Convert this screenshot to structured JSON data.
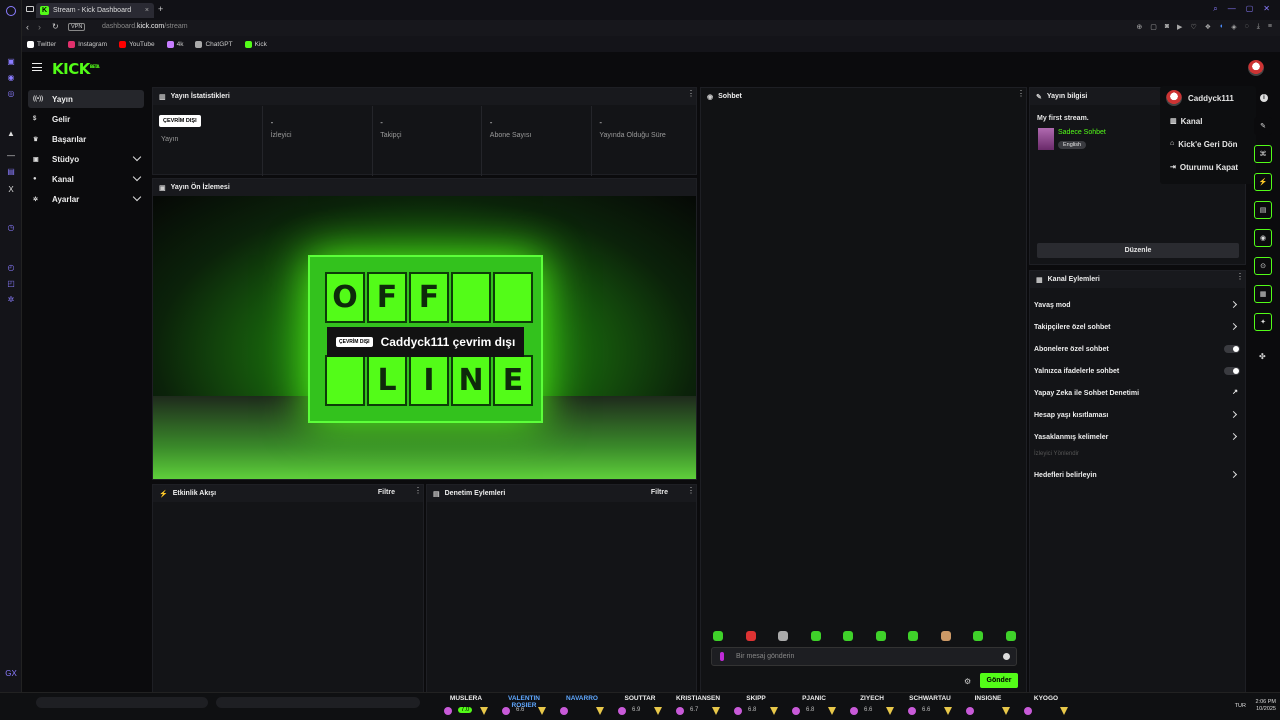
{
  "browser": {
    "tab_title": "Stream - Kick Dashboard",
    "url_domain": "dashboard.",
    "url_host": "kick.com",
    "url_path": "/stream",
    "vpn": "VPN"
  },
  "bookmarks": [
    {
      "label": "Twitter",
      "icon": "x-icon",
      "color": "#ffffff"
    },
    {
      "label": "Instagram",
      "icon": "instagram-icon",
      "color": "#e1306c"
    },
    {
      "label": "YouTube",
      "icon": "youtube-icon",
      "color": "#ff0000"
    },
    {
      "label": "4k",
      "icon": "gem-icon",
      "color": "#c77dff"
    },
    {
      "label": "ChatGPT",
      "icon": "chatgpt-icon",
      "color": "#aaaaaa"
    },
    {
      "label": "Kick",
      "icon": "kick-icon",
      "color": "#53fc18"
    }
  ],
  "app": {
    "logo": "KICK",
    "logo_sup": "BETA",
    "accent": "#53fc18"
  },
  "sidebar": {
    "items": [
      {
        "label": "Yayın",
        "icon": "broadcast-icon"
      },
      {
        "label": "Gelir",
        "icon": "dollar-icon"
      },
      {
        "label": "Başarılar",
        "icon": "trophy-icon"
      },
      {
        "label": "Stüdyo",
        "icon": "film-icon"
      },
      {
        "label": "Kanal",
        "icon": "user-icon"
      },
      {
        "label": "Ayarlar",
        "icon": "gear-icon"
      }
    ]
  },
  "stats": {
    "title": "Yayın İstatistikleri",
    "badge": "ÇEVRİM DIŞI",
    "cells": [
      {
        "value": "",
        "label": "Yayın"
      },
      {
        "value": "-",
        "label": "İzleyici"
      },
      {
        "value": "-",
        "label": "Takipçi"
      },
      {
        "value": "-",
        "label": "Abone Sayısı"
      },
      {
        "value": "-",
        "label": "Yayında Olduğu Süre"
      }
    ]
  },
  "preview": {
    "title": "Yayın Ön İzlemesi",
    "badge": "ÇEVRİM DIŞI",
    "offline_text": "Caddyck111 çevrim dışı",
    "letters_top": [
      "O",
      "F",
      "F",
      "",
      ""
    ],
    "letters_bottom": [
      "",
      "L",
      "I",
      "N",
      "E"
    ]
  },
  "activity": {
    "title": "Etkinlik Akışı",
    "filter": "Filtre"
  },
  "moderation": {
    "title": "Denetim Eylemleri",
    "filter": "Filtre"
  },
  "chat": {
    "title": "Sohbet",
    "placeholder": "Bir mesaj gönderin",
    "send": "Gönder"
  },
  "stream_info": {
    "title": "Yayın bilgisi",
    "stream_title": "My first stream.",
    "category": "Sadece Sohbet",
    "language": "English",
    "edit": "Düzenle"
  },
  "actions": {
    "title": "Kanal Eylemleri",
    "items": [
      {
        "label": "Yavaş mod",
        "kind": "arrow"
      },
      {
        "label": "Takipçilere özel sohbet",
        "kind": "arrow"
      },
      {
        "label": "Abonelere özel sohbet",
        "kind": "toggle"
      },
      {
        "label": "Yalnızca ifadelerle sohbet",
        "kind": "toggle"
      },
      {
        "label": "Yapay Zeka ile Sohbet Denetimi",
        "kind": "external"
      },
      {
        "label": "Hesap yaşı kısıtlaması",
        "kind": "arrow"
      },
      {
        "label": "Yasaklanmış kelimeler",
        "kind": "arrow"
      }
    ],
    "section": "İzleyici Yönlendir",
    "target": "Hedefleri belirleyin"
  },
  "user_menu": {
    "username": "Caddyck111",
    "items": [
      "Kanal",
      "Kick'e Geri Dön",
      "Oturumu Kapat"
    ]
  },
  "taskbar": {
    "players": [
      {
        "name": "MUSLERA",
        "rating": "7.0",
        "blue": false
      },
      {
        "name": "VALENTIN ROSIER",
        "rating": "6.6",
        "blue": true
      },
      {
        "name": "NAVARRO",
        "rating": "",
        "blue": true
      },
      {
        "name": "SOUTTAR",
        "rating": "6.9",
        "blue": false
      },
      {
        "name": "KRISTIANSEN",
        "rating": "6.7",
        "blue": false
      },
      {
        "name": "SKIPP",
        "rating": "6.8",
        "blue": false
      },
      {
        "name": "PJANIC",
        "rating": "6.8",
        "blue": false
      },
      {
        "name": "ZIYECH",
        "rating": "6.6",
        "blue": false
      },
      {
        "name": "SCHWARTAU",
        "rating": "6.6",
        "blue": false
      },
      {
        "name": "INSIGNE",
        "rating": "",
        "blue": false
      },
      {
        "name": "KYOGO",
        "rating": "",
        "blue": false
      }
    ],
    "lang": "TUR",
    "time": "2:06 PM",
    "date": "10/2025"
  }
}
